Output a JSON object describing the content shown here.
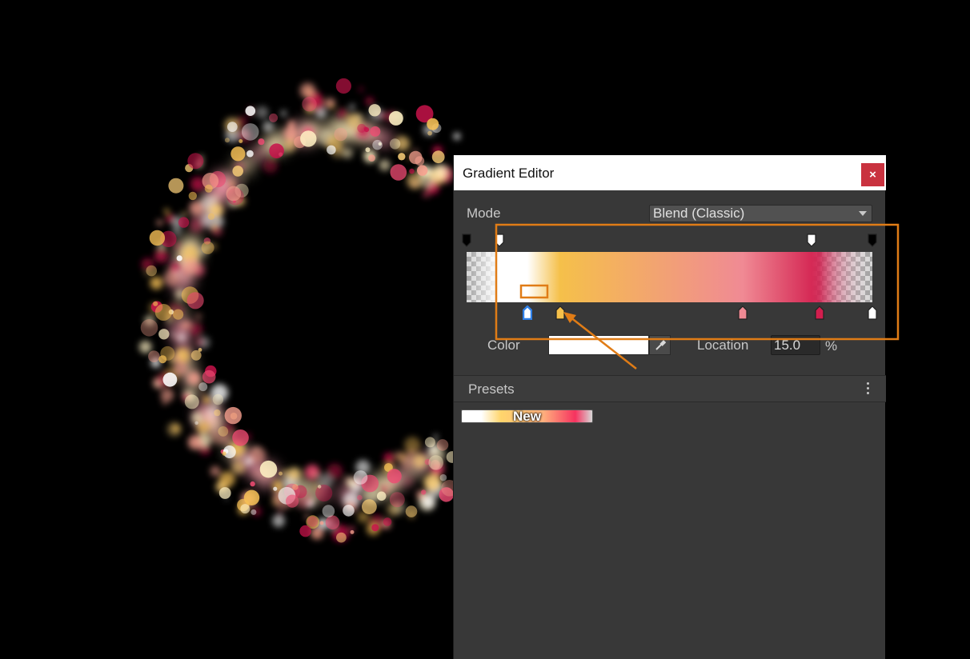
{
  "window": {
    "title": "Gradient Editor",
    "close_label": "×"
  },
  "mode": {
    "label": "Mode",
    "value": "Blend (Classic)"
  },
  "gradient": {
    "alpha_keys": [
      {
        "location": 0,
        "color": "#000000"
      },
      {
        "location": 8,
        "color": "#ffffff"
      },
      {
        "location": 85,
        "color": "#ffffff"
      },
      {
        "location": 100,
        "color": "#000000"
      }
    ],
    "color_keys": [
      {
        "location": 15,
        "color": "#ffffff",
        "selected": true
      },
      {
        "location": 23,
        "color": "#f5c04a",
        "selected": false
      },
      {
        "location": 68,
        "color": "#f08a94",
        "selected": false
      },
      {
        "location": 87,
        "color": "#d21e4e",
        "selected": false
      },
      {
        "location": 100,
        "color": "#ffffff",
        "selected": false
      }
    ]
  },
  "selected_key": {
    "color_label": "Color",
    "color_value": "#ffffff",
    "location_label": "Location",
    "location_value": "15.0",
    "percent_sign": "%"
  },
  "presets": {
    "label": "Presets",
    "items": [
      {
        "name": "New"
      }
    ]
  },
  "colors": {
    "annotation": "#e07c16",
    "window_bg": "#383838",
    "close_btn": "#c9323f"
  }
}
